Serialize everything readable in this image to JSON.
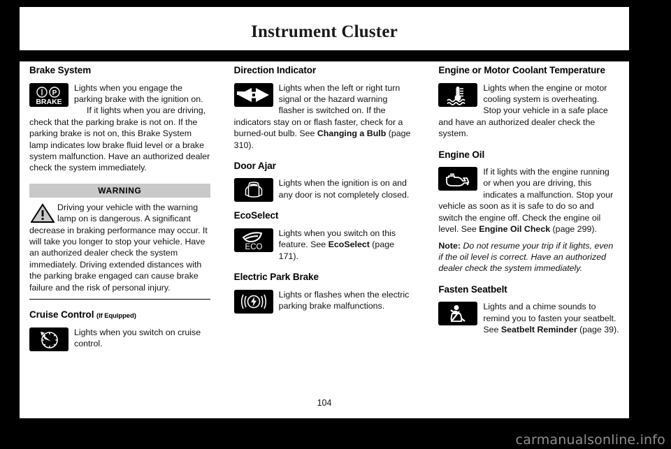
{
  "page": {
    "title": "Instrument Cluster",
    "number": "104",
    "watermark": "carmanualsonline.info"
  },
  "columns": [
    {
      "id": "left",
      "blocks": [
        {
          "heading": "Brake System",
          "heading_sub": "",
          "icon": "brake-system-icon",
          "text_lead": "Lights when you engage the parking brake with the ignition on.",
          "text_body": "If it lights when you are driving, check that the parking brake is not on. If the parking brake is not on, this Brake System lamp indicates low brake fluid level or a brake system malfunction. Have an authorized dealer check the system immediately."
        },
        {
          "warning_label": "WARNING",
          "icon": "warning-triangle-icon",
          "warning_text": "Driving your vehicle with the warning lamp on is dangerous. A significant decrease in braking performance may occur. It will take you longer to stop your vehicle. Have an authorized dealer check the system immediately. Driving extended distances with the parking brake engaged can cause brake failure and the risk of personal injury."
        },
        {
          "heading": "Cruise Control",
          "heading_sub": "(If Equipped)",
          "icon": "cruise-control-icon",
          "text_lead": "Lights when you switch on cruise control.",
          "text_body": ""
        }
      ]
    },
    {
      "id": "middle",
      "blocks": [
        {
          "heading": "Direction Indicator",
          "heading_sub": "",
          "icon": "direction-indicator-icon",
          "text_lead": "Lights when the left or right turn signal or the hazard warning flasher is switched on. If the indicators stay on or flash faster, check for a burned-out bulb.  See ",
          "text_link": "Changing a Bulb",
          "text_tail": " (page 310)."
        },
        {
          "heading": "Door Ajar",
          "heading_sub": "",
          "icon": "door-ajar-icon",
          "text_lead": "Lights when the ignition is on and any door is not completely closed.",
          "text_link": "",
          "text_tail": ""
        },
        {
          "heading": "EcoSelect",
          "heading_sub": "",
          "icon": "ecoselect-icon",
          "text_lead": "Lights when you switch on this feature.  See ",
          "text_link": "EcoSelect",
          "text_tail": " (page 171)."
        },
        {
          "heading": "Electric Park Brake",
          "heading_sub": "",
          "icon": "electric-park-brake-icon",
          "text_lead": "Lights or flashes when the electric parking brake malfunctions.",
          "text_link": "",
          "text_tail": ""
        }
      ]
    },
    {
      "id": "right",
      "blocks": [
        {
          "heading": "Engine or Motor Coolant Temperature",
          "heading_sub": "",
          "icon": "coolant-temperature-icon",
          "text_lead": "Lights when the engine or motor cooling system is overheating. Stop your vehicle in a safe place and have an authorized dealer check the system.",
          "text_link": "",
          "text_tail": ""
        },
        {
          "heading": "Engine Oil",
          "heading_sub": "",
          "icon": "engine-oil-icon",
          "text_lead": "If it lights with the engine running or when you are driving, this indicates a malfunction. Stop your vehicle as soon as it is safe to do so and switch the engine off. Check the engine oil level.  See ",
          "text_link": "Engine Oil Check",
          "text_tail": " (page 299).",
          "note_label": "Note:",
          "note_text": " Do not resume your trip if it lights, even if the oil level is correct. Have an authorized dealer check the system immediately."
        },
        {
          "heading": "Fasten Seatbelt",
          "heading_sub": "",
          "icon": "fasten-seatbelt-icon",
          "text_lead": "Lights and a chime sounds to remind you to fasten your seatbelt. See ",
          "text_link": "Seatbelt Reminder",
          "text_tail": " (page 39)."
        }
      ]
    }
  ],
  "colors": {
    "page_background": "#000000",
    "sheet": "#ffffff",
    "text": "#111111",
    "warning_bar": "#c9c9c9",
    "watermark": "#8e8e8e"
  }
}
